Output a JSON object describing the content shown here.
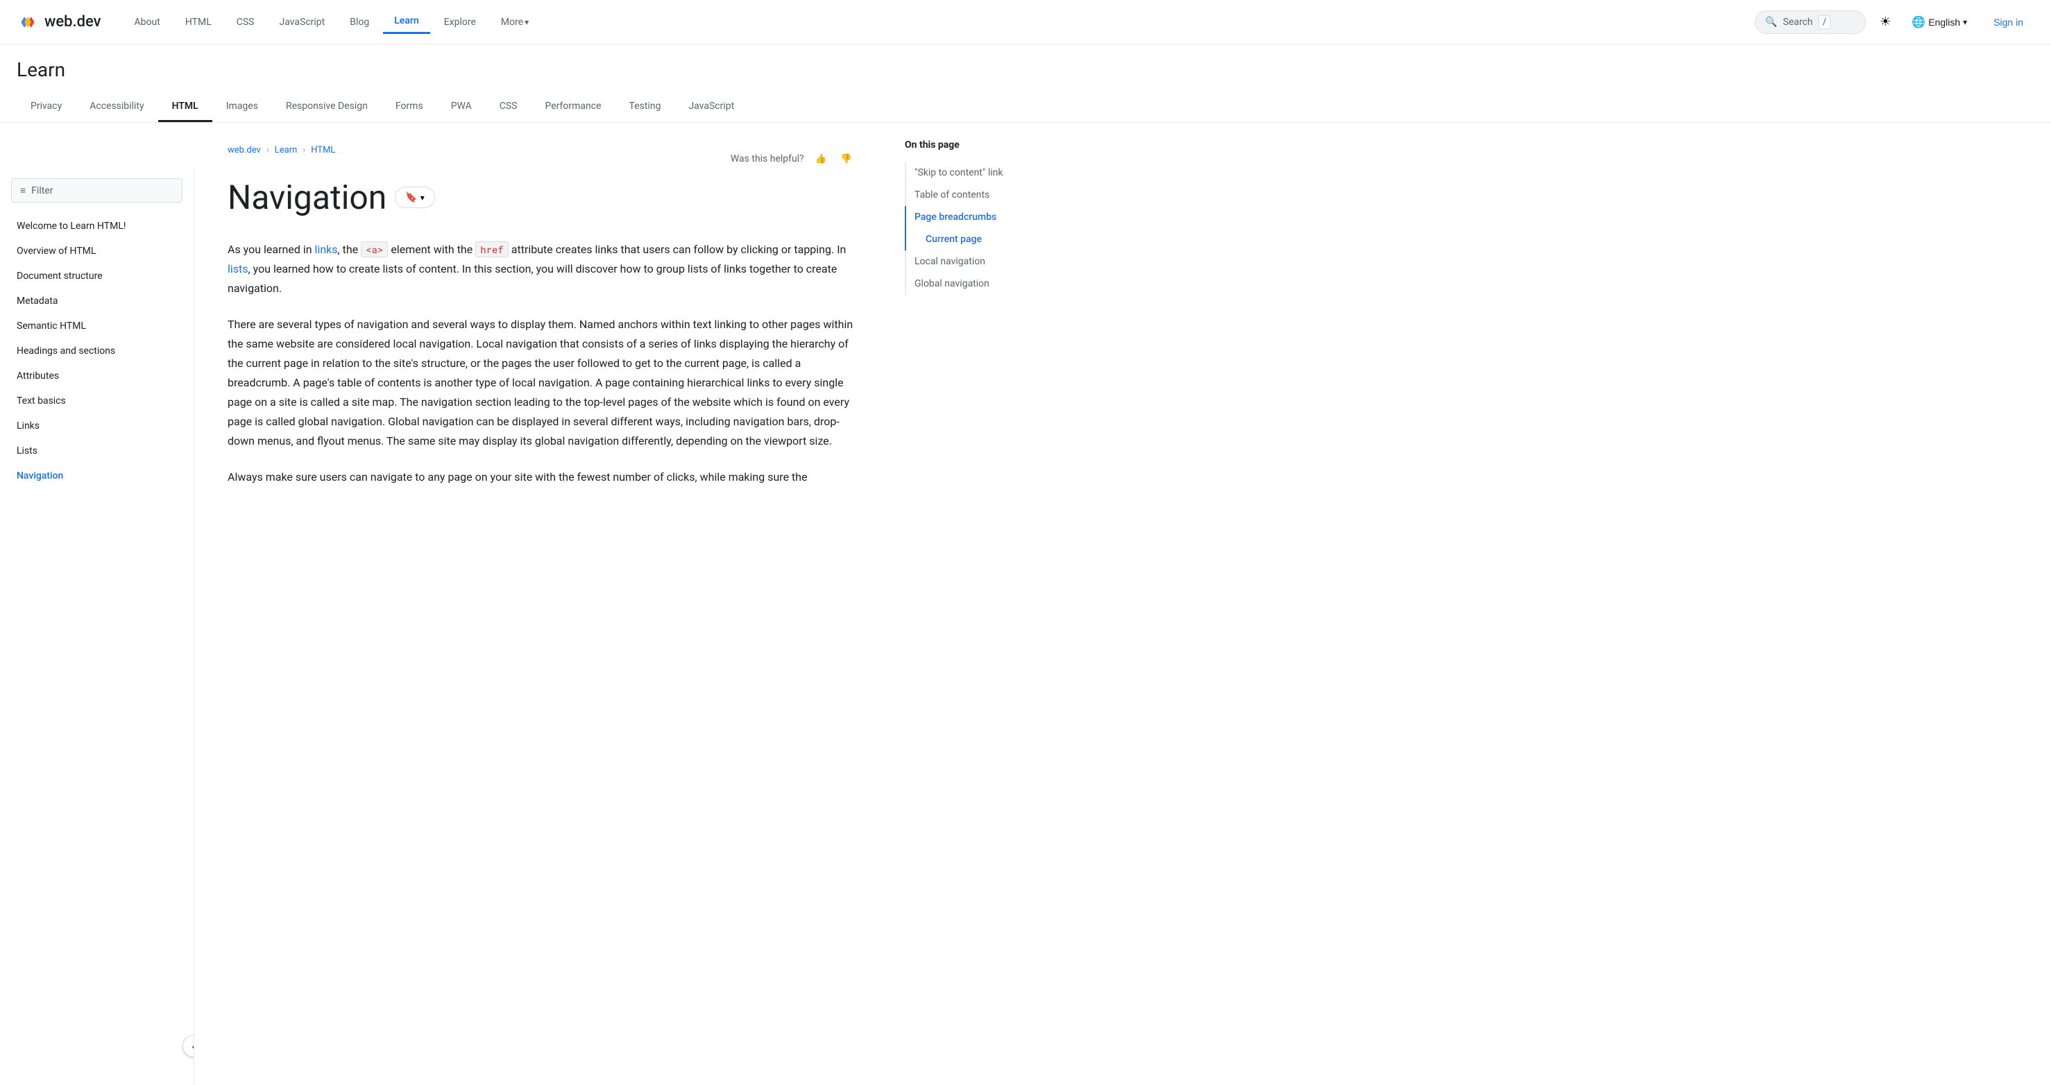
{
  "topnav": {
    "logo": "web.dev",
    "links": [
      "About",
      "HTML",
      "CSS",
      "JavaScript",
      "Blog",
      "Learn",
      "Explore",
      "More"
    ],
    "active_link": "Learn",
    "search_placeholder": "Search",
    "search_shortcut": "/",
    "language": "English",
    "signin": "Sign in"
  },
  "learn_header": {
    "title": "Learn",
    "tabs": [
      "Privacy",
      "Accessibility",
      "HTML",
      "Images",
      "Responsive Design",
      "Forms",
      "PWA",
      "CSS",
      "Performance",
      "Testing",
      "JavaScript"
    ],
    "active_tab": "HTML"
  },
  "sidebar": {
    "filter_placeholder": "Filter",
    "items": [
      "Welcome to Learn HTML!",
      "Overview of HTML",
      "Document structure",
      "Metadata",
      "Semantic HTML",
      "Headings and sections",
      "Attributes",
      "Text basics",
      "Links",
      "Lists",
      "Navigation"
    ],
    "active_item": "Navigation",
    "collapse_icon": "‹"
  },
  "breadcrumb": {
    "items": [
      "web.dev",
      "Learn",
      "HTML"
    ],
    "separator": "›"
  },
  "helpful": {
    "label": "Was this helpful?",
    "thumbup": "👍",
    "thumbdown": "👎"
  },
  "page": {
    "title": "Navigation",
    "bookmark_label": "🔖",
    "paragraphs": [
      "As you learned in links, the <a> element with the href attribute creates links that users can follow by clicking or tapping. In lists, you learned how to create lists of content. In this section, you will discover how to group lists of links together to create navigation.",
      "There are several types of navigation and several ways to display them. Named anchors within text linking to other pages within the same website are considered local navigation. Local navigation that consists of a series of links displaying the hierarchy of the current page in relation to the site's structure, or the pages the user followed to get to the current page, is called a breadcrumb. A page's table of contents is another type of local navigation. A page containing hierarchical links to every single page on a site is called a site map. The navigation section leading to the top-level pages of the website which is found on every page is called global navigation. Global navigation can be displayed in several different ways, including navigation bars, drop-down menus, and flyout menus. The same site may display its global navigation differently, depending on the viewport size.",
      "Always make sure users can navigate to any page on your site with the fewest number of clicks, while making sure the"
    ],
    "inline_codes": [
      "<a>",
      "href"
    ],
    "inline_links": [
      "links",
      "lists"
    ]
  },
  "toc": {
    "title": "On this page",
    "items": [
      {
        "label": "\"Skip to content\" link",
        "active": false,
        "sub": false
      },
      {
        "label": "Table of contents",
        "active": false,
        "sub": false
      },
      {
        "label": "Page breadcrumbs",
        "active": true,
        "sub": false
      },
      {
        "label": "Current page",
        "active": false,
        "sub": true
      },
      {
        "label": "Local navigation",
        "active": false,
        "sub": false
      },
      {
        "label": "Global navigation",
        "active": false,
        "sub": false
      }
    ]
  }
}
